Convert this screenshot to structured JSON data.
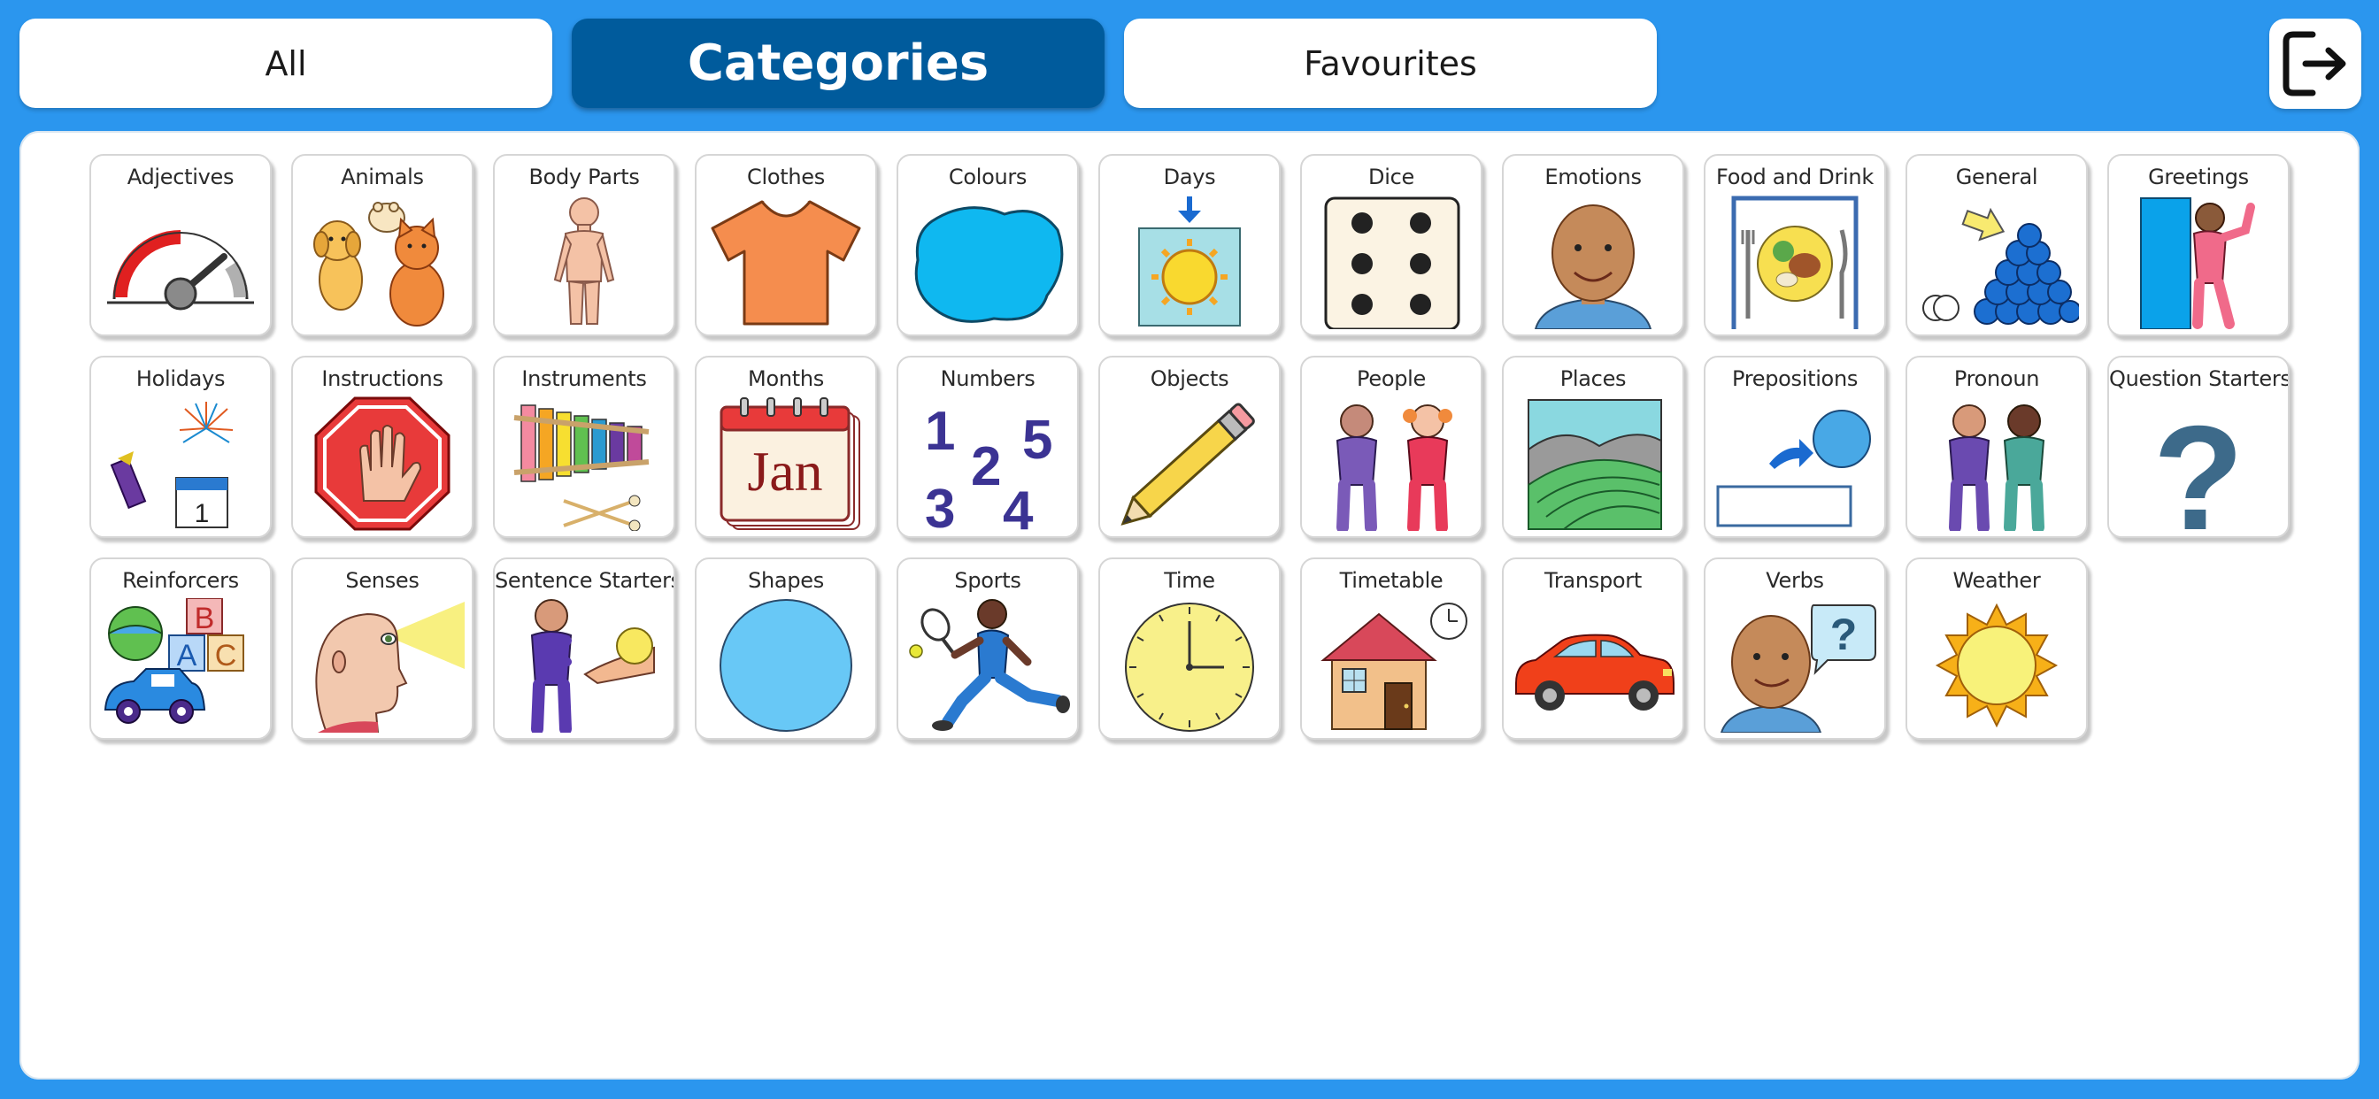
{
  "tabs": {
    "all": "All",
    "categories": "Categories",
    "favourites": "Favourites"
  },
  "categories": {
    "adjectives": "Adjectives",
    "animals": "Animals",
    "body_parts": "Body Parts",
    "clothes": "Clothes",
    "colours": "Colours",
    "days": "Days",
    "dice": "Dice",
    "emotions": "Emotions",
    "food_and_drink": "Food and Drink",
    "general": "General",
    "greetings": "Greetings",
    "holidays": "Holidays",
    "instructions": "Instructions",
    "instruments": "Instruments",
    "months": "Months",
    "numbers": "Numbers",
    "objects": "Objects",
    "people": "People",
    "places": "Places",
    "prepositions": "Prepositions",
    "pronoun": "Pronoun",
    "question_starters": "Question Starters",
    "reinforcers": "Reinforcers",
    "senses": "Senses",
    "sentence_starters": "Sentence Starters",
    "shapes": "Shapes",
    "sports": "Sports",
    "time": "Time",
    "timetable": "Timetable",
    "transport": "Transport",
    "verbs": "Verbs",
    "weather": "Weather"
  },
  "icon_text": {
    "month": "Jan",
    "calendar_day": "1",
    "numbers": [
      "1",
      "2",
      "3",
      "4",
      "5"
    ],
    "question_mark": "?",
    "blocks": [
      "B",
      "A",
      "C"
    ]
  },
  "colors": {
    "background": "#2b96ee",
    "active_tab": "#005b9c",
    "panel": "#ffffff"
  }
}
